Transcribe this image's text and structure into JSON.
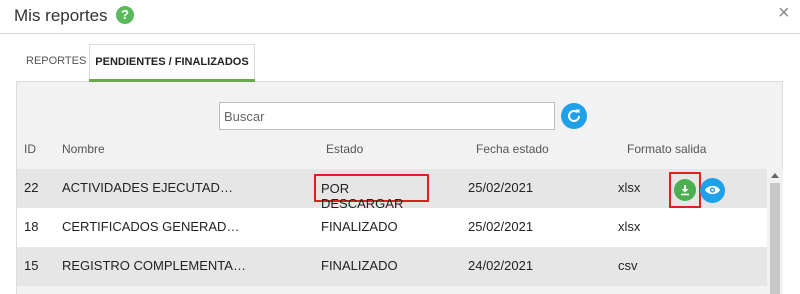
{
  "window": {
    "title": "Mis reportes",
    "help_icon": "?",
    "close_icon": "×"
  },
  "tabs": [
    {
      "label": "REPORTES",
      "active": false
    },
    {
      "label": "PENDIENTES / FINALIZADOS",
      "active": true
    }
  ],
  "search": {
    "placeholder": "Buscar",
    "value": ""
  },
  "table": {
    "columns": [
      "ID",
      "Nombre",
      "Estado",
      "Fecha estado",
      "Formato salida"
    ],
    "rows": [
      {
        "id": "22",
        "name": "ACTIVIDADES EJECUTAD…",
        "status": "POR DESCARGAR",
        "date": "25/02/2021",
        "format": "xlsx",
        "actions": [
          "download-icon",
          "eye-icon"
        ]
      },
      {
        "id": "18",
        "name": "CERTIFICADOS GENERAD…",
        "status": "FINALIZADO",
        "date": "25/02/2021",
        "format": "xlsx",
        "actions": []
      },
      {
        "id": "15",
        "name": "REGISTRO COMPLEMENTA…",
        "status": "FINALIZADO",
        "date": "24/02/2021",
        "format": "csv",
        "actions": []
      }
    ]
  },
  "colors": {
    "accent_green": "#5cb85c",
    "accent_blue": "#1da1e8",
    "highlight_red": "#e02020",
    "tab_underline": "#6aa84f"
  }
}
